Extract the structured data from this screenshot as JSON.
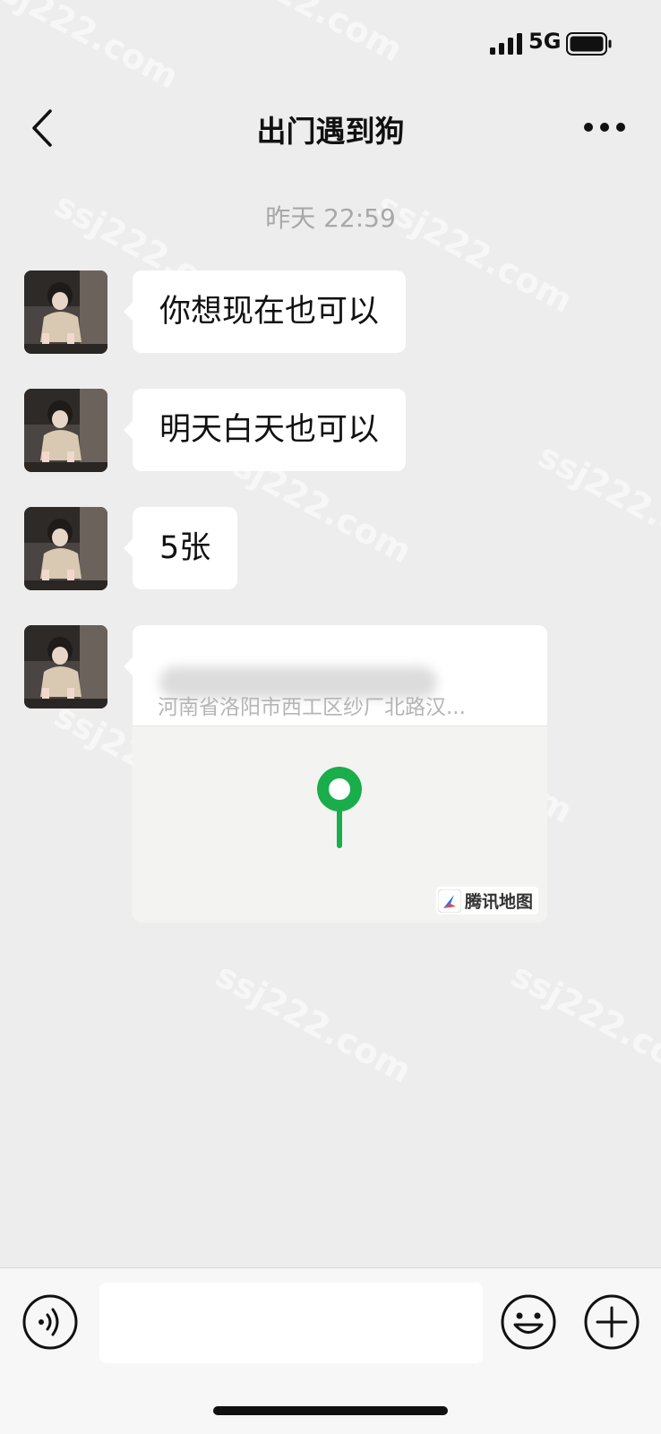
{
  "status_bar": {
    "network": "5G"
  },
  "header": {
    "title": "出门遇到狗"
  },
  "timestamp": "昨天 22:59",
  "messages": [
    {
      "text": "你想现在也可以"
    },
    {
      "text": "明天白天也可以"
    },
    {
      "text": "5张"
    }
  ],
  "location": {
    "address": "河南省洛阳市西工区纱厂北路汉...",
    "map_provider": "腾讯地图"
  },
  "watermark": "ssj222.com",
  "colors": {
    "pin": "#1aad4b",
    "background": "#ededed",
    "bubble": "#ffffff"
  },
  "icons": [
    "signal-icon",
    "battery-icon",
    "back-icon",
    "more-icon",
    "voice-icon",
    "emoji-icon",
    "plus-icon",
    "map-pin-icon"
  ]
}
